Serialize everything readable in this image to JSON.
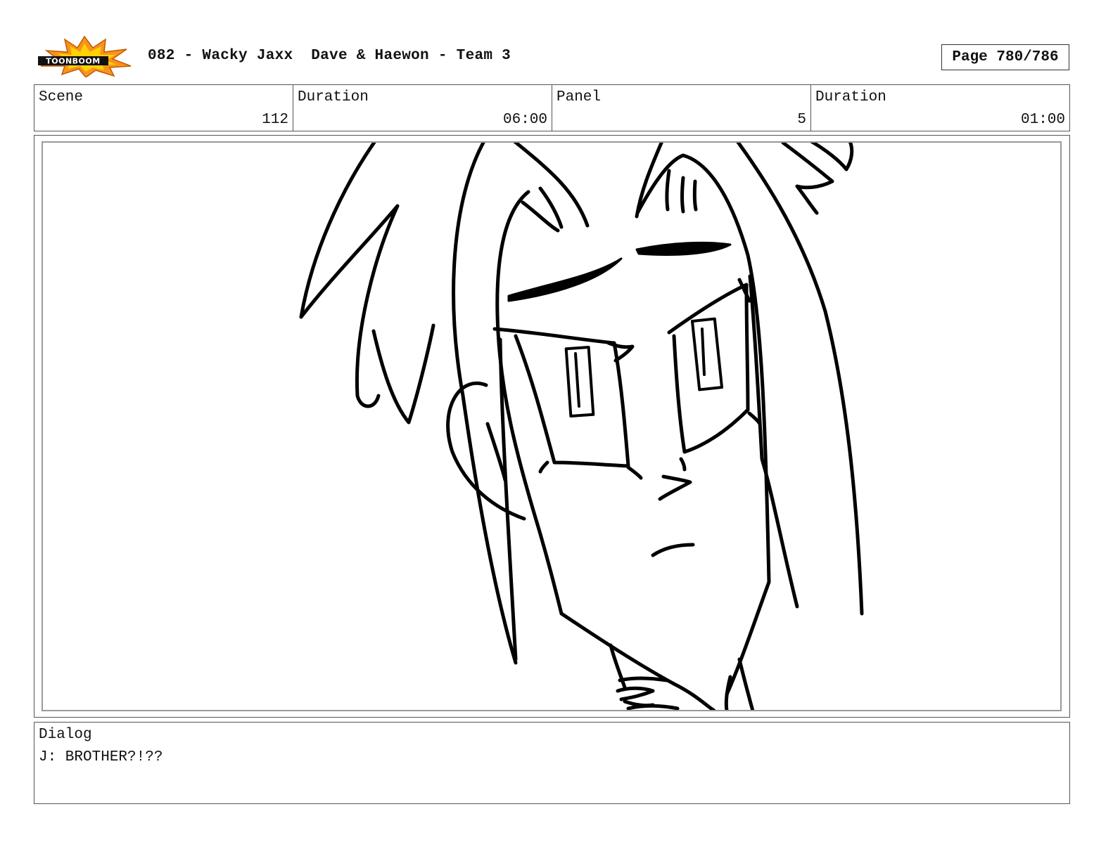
{
  "header": {
    "logo_text": "TOONBOOM",
    "title": "082 - Wacky Jaxx  Dave & Haewon - Team 3",
    "page": "Page 780/786"
  },
  "info": {
    "scene_label": "Scene",
    "scene_value": "112",
    "scene_duration_label": "Duration",
    "scene_duration_value": "06:00",
    "panel_label": "Panel",
    "panel_value": "5",
    "panel_duration_label": "Duration",
    "panel_duration_value": "01:00"
  },
  "dialog": {
    "label": "Dialog",
    "text": "J: BROTHER?!??"
  },
  "colors": {
    "logo_orange": "#f7941d",
    "logo_yellow": "#ffd200",
    "logo_black": "#111111"
  }
}
